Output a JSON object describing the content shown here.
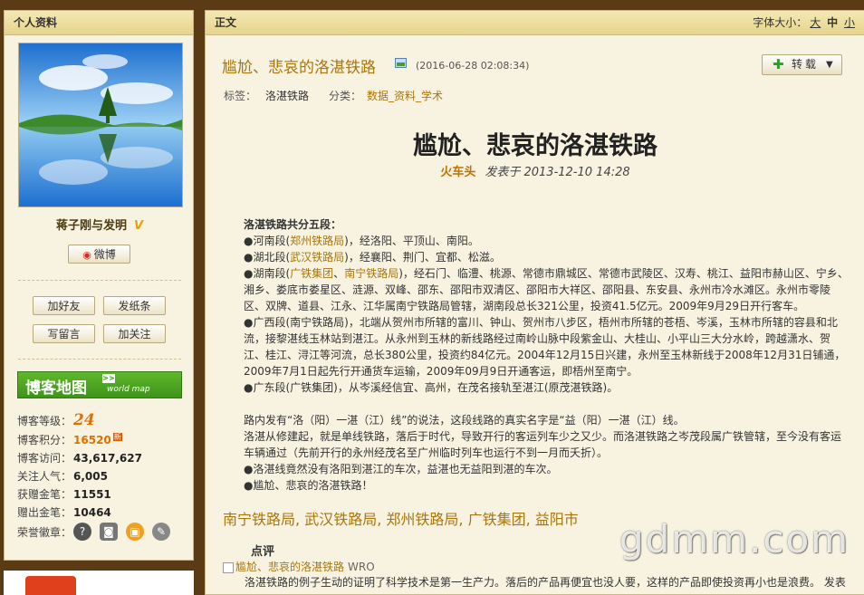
{
  "sidebar": {
    "panel_title": "个人资料",
    "blog_name": "蒋子刚与发明",
    "verified_mark": "V",
    "weibo_button": "微博",
    "buttons": [
      "加好友",
      "发纸条",
      "写留言",
      "加关注"
    ],
    "blog_map": {
      "title": "博客地图",
      "subtitle": "world map",
      "arrow": ">>"
    },
    "stats": {
      "level_label": "博客等级：",
      "level_value": "24",
      "points_label": "博客积分：",
      "points_value": "16520",
      "points_badge": "新",
      "visits_label": "博客访问：",
      "visits_value": "43,617,627",
      "popularity_label": "关注人气：",
      "popularity_value": "6,005",
      "gold_pen_label": "获赠金笔：",
      "gold_pen_value": "11551",
      "gift_pen_label": "赠出金笔：",
      "gift_pen_value": "10464",
      "medals_label": "荣誉徽章："
    },
    "medal_icons": [
      "quality-medal-icon",
      "camera-medal-icon",
      "lock-medal-icon",
      "pen-medal-icon"
    ]
  },
  "main": {
    "panel_title": "正文",
    "font_size_label": "字体大小：",
    "font_sizes": [
      "大",
      "中",
      "小"
    ],
    "article": {
      "title": "尴尬、悲哀的洛湛铁路",
      "time": "(2016-06-28 02:08:34)",
      "repost_label": "转载",
      "tags_label": "标签：",
      "tag": "洛湛铁路",
      "category_label": "分类：",
      "category": "数据_资料_学术",
      "big_title": "尴尬、悲哀的洛湛铁路",
      "author": "火车头",
      "posted": "发表于 2013-12-10 14:28"
    },
    "body": {
      "section_title": "洛湛铁路共分五段：",
      "henan_pre": "●河南段(",
      "henan_link": "郑州铁路局",
      "henan_post": ")，经洛阳、平顶山、南阳。",
      "hubei_pre": "●湖北段(",
      "hubei_link": "武汉铁路局",
      "hubei_post": ")，经襄阳、荆门、宜都、松滋。",
      "hunan_pre": "●湖南段(",
      "hunan_link1": "广铁集团",
      "hunan_sep": "、",
      "hunan_link2": "南宁铁路局",
      "hunan_post": ")，经石门、临澧、桃源、常德市鼎城区、常德市武陵区、汉寿、桃江、益阳市赫山区、宁乡、湘乡、娄底市娄星区、涟源、双峰、邵东、邵阳市双清区、邵阳市大祥区、邵阳县、东安县、永州市冷水滩区。永州市零陵区、双牌、道县、江永、江华属南宁铁路局管辖，湖南段总长321公里，投资41.5亿元。2009年9月29日开行客车。",
      "guangxi": "●广西段(南宁铁路局)，北端从贺州市所辖的富川、钟山、贺州市八步区，梧州市所辖的苍梧、岑溪，玉林市所辖的容县和北流，接黎湛线玉林站到湛江。从永州到玉林的新线路经过南岭山脉中段紫金山、大桂山、小平山三大分水岭，跨越潇水、贺江、桂江、浔江等河流，总长380公里，投资约84亿元。2004年12月15日兴建，永州至玉林新线于2008年12月31日铺通，2009年7月1日起先行开通货车运输，2009年09月9日开通客运，即梧州至南宁。",
      "guangdong": "●广东段(广铁集团)，从岑溪经信宜、高州，在茂名接轨至湛江(原茂湛铁路)。",
      "para1": "路内发有“洛（阳）一湛（江）线”的说法，这段线路的真实名字是“益（阳）一湛（江）线。",
      "para2": "洛湛从修建起，就是单线铁路，落后于时代，导致开行的客运列车少之又少。而洛湛铁路之岑茂段属广铁管辖，至今没有客运车辆通过（先前开行的永州经茂名至广州临时列车也运行不到一月而夭折）。",
      "bullet1": "●洛湛线竟然没有洛阳到湛江的车次，益湛也无益阳到湛的车次。",
      "bullet2": "●尴尬、悲哀的洛湛铁路！"
    },
    "tag_links": [
      "南宁铁路局,",
      "武汉铁路局,",
      "郑州铁路局,",
      "广铁集团,",
      "益阳市"
    ],
    "comments_title": "点评",
    "comment_link": "尴尬、悲哀的洛湛铁路",
    "comment_link_tail": "WRO",
    "comment_text": "洛湛铁路的例子生动的证明了科学技术是第一生产力。落后的产品再便宜也没人要，这样的产品即使投资再小也是浪费。 发表"
  },
  "watermark": "gdmm.com",
  "colors": {
    "accent": "#a8750f",
    "panel_bg": "#f7f3e0",
    "page_bg": "#5b3a16",
    "map_green": "#3e9419"
  }
}
